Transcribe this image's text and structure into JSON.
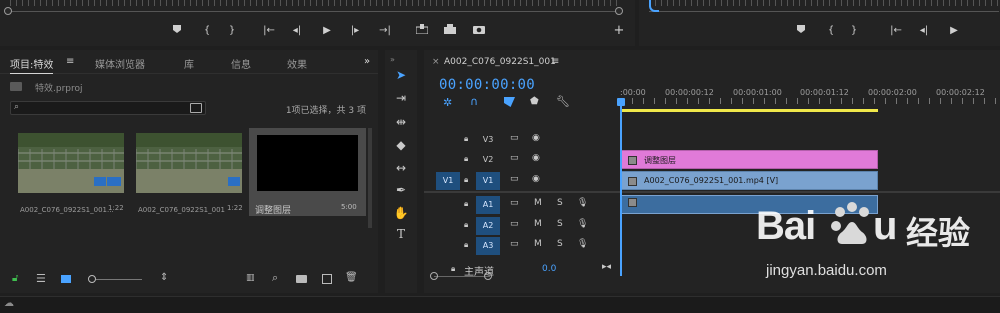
{
  "source_monitor": {
    "controls": [
      "marker",
      "mark-in",
      "mark-out",
      "go-to-in",
      "step-back",
      "play",
      "step-forward",
      "go-to-out",
      "insert",
      "overwrite",
      "export-frame",
      "add"
    ]
  },
  "program_monitor": {
    "controls": [
      "marker",
      "mark-in",
      "mark-out",
      "go-to-in",
      "step-back",
      "play"
    ]
  },
  "project": {
    "tabs": [
      "项目:特效",
      "媒体浏览器",
      "库",
      "信息",
      "效果"
    ],
    "file": "特效.prproj",
    "selection_count": "1项已选择，共 3 项",
    "items": [
      {
        "name": "A002_C076_0922S1_001...",
        "duration": "1:22"
      },
      {
        "name": "A002_C076_0922S1_001",
        "duration": "1:22"
      },
      {
        "name": "调整图层",
        "duration": "5:00"
      }
    ]
  },
  "timeline": {
    "sequence_name": "A002_C076_0922S1_001",
    "close_label": "×",
    "timecode": "00:00:00:00",
    "ruler": [
      ":00:00",
      "00:00:00:12",
      "00:00:01:00",
      "00:00:01:12",
      "00:00:02:00",
      "00:00:02:12"
    ],
    "tracks": [
      {
        "name": "V3"
      },
      {
        "name": "V2"
      },
      {
        "name": "V1",
        "source": "V1"
      },
      {
        "name": "A1",
        "m": "M",
        "s": "S"
      },
      {
        "name": "A2",
        "m": "M",
        "s": "S"
      },
      {
        "name": "A3",
        "m": "M",
        "s": "S"
      }
    ],
    "clips": {
      "v2": "调整图层",
      "v1": "A002_C076_0922S1_001.mp4 [V]"
    },
    "master_label": "主声道",
    "master_value": "0.0"
  },
  "watermark": {
    "brand_latin_a": "Bai",
    "brand_latin_b": "u",
    "brand_cn": "经验",
    "url": "jingyan.baidu.com"
  },
  "colors": {
    "accent": "#4aa3ff",
    "adjustment_clip": "#e07ad8",
    "video_clip": "#7aa2cf",
    "work_area": "#f0e84a"
  }
}
